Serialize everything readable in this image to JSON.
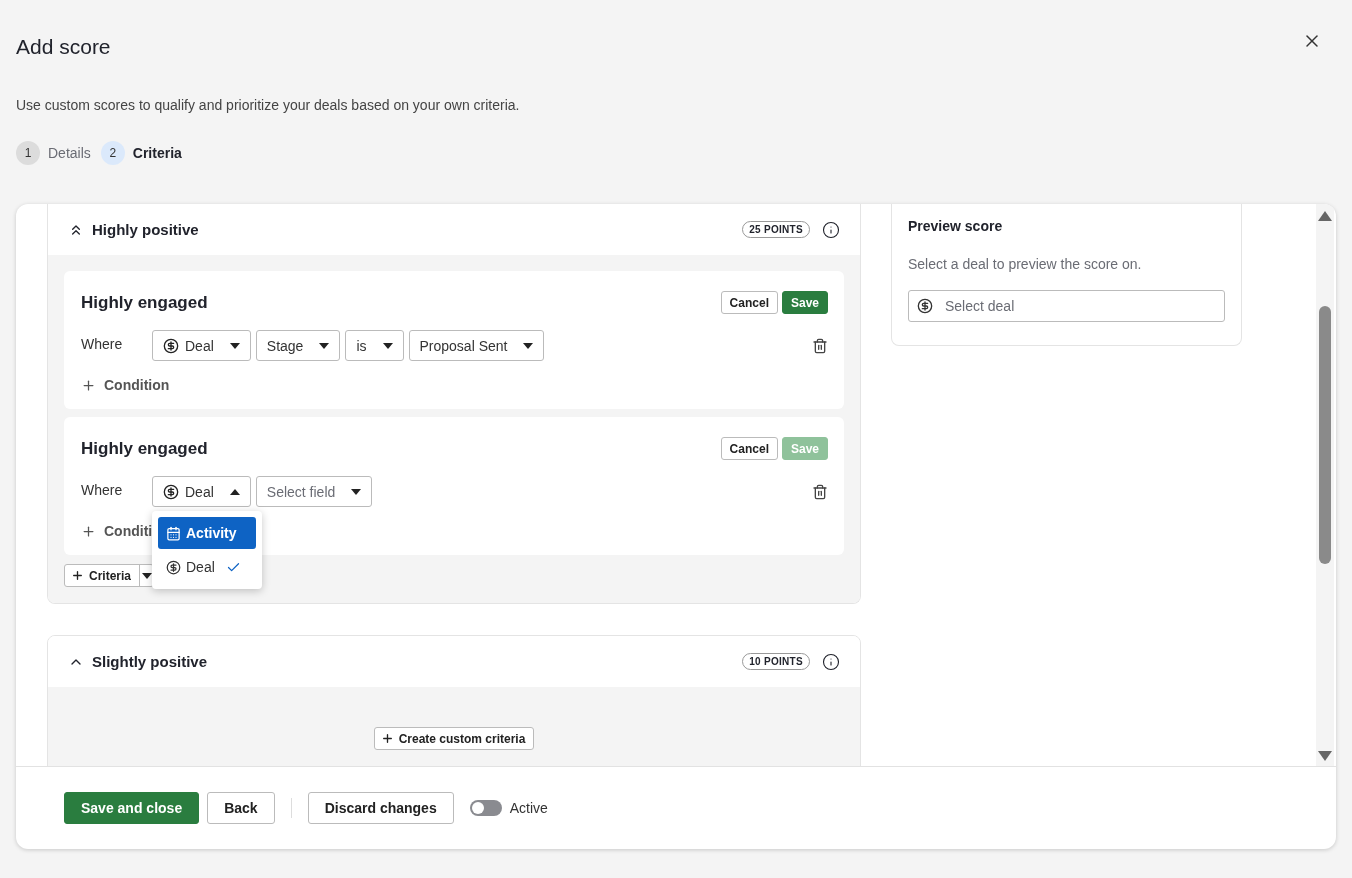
{
  "dialog": {
    "title": "Add score",
    "description": "Use custom scores to qualify and prioritize your deals based on your own criteria."
  },
  "steps": [
    {
      "number": "1",
      "label": "Details",
      "selected": false
    },
    {
      "number": "2",
      "label": "Criteria",
      "selected": true
    }
  ],
  "sections": [
    {
      "kind": "double",
      "title": "Highly positive",
      "points": "25 POINTS",
      "expanded": true,
      "criteria": [
        {
          "title": "Highly engaged",
          "cancel": "Cancel",
          "save": "Save",
          "save_disabled": false,
          "where": "Where",
          "condition": "Condition",
          "filters": [
            {
              "kind": "entity",
              "label": "Deal",
              "open": false
            },
            {
              "kind": "field",
              "label": "Stage",
              "open": false
            },
            {
              "kind": "field",
              "label": "is",
              "open": false
            },
            {
              "kind": "field",
              "label": "Proposal Sent",
              "open": false
            }
          ]
        },
        {
          "title": "Highly engaged",
          "cancel": "Cancel",
          "save": "Save",
          "save_disabled": true,
          "where": "Where",
          "condition": "Conditi",
          "filters": [
            {
              "kind": "entity",
              "label": "Deal",
              "open": true,
              "menu": [
                {
                  "kind": "calendar",
                  "label": "Activity",
                  "highlighted": true,
                  "selected": false
                },
                {
                  "kind": "dollar",
                  "label": "Deal",
                  "highlighted": false,
                  "selected": true
                }
              ]
            },
            {
              "kind": "placeholder",
              "label": "Select field",
              "open": false
            }
          ]
        }
      ],
      "add_button": "Criteria"
    },
    {
      "kind": "single",
      "title": "Slightly positive",
      "points": "10 POINTS",
      "expanded": true,
      "create_button": "Create custom criteria"
    }
  ],
  "preview": {
    "title": "Preview score",
    "description": "Select a deal to preview the score on.",
    "placeholder": "Select deal"
  },
  "footer": {
    "save": "Save and close",
    "back": "Back",
    "discard": "Discard changes",
    "toggle": {
      "label": "Active",
      "on": false
    }
  }
}
